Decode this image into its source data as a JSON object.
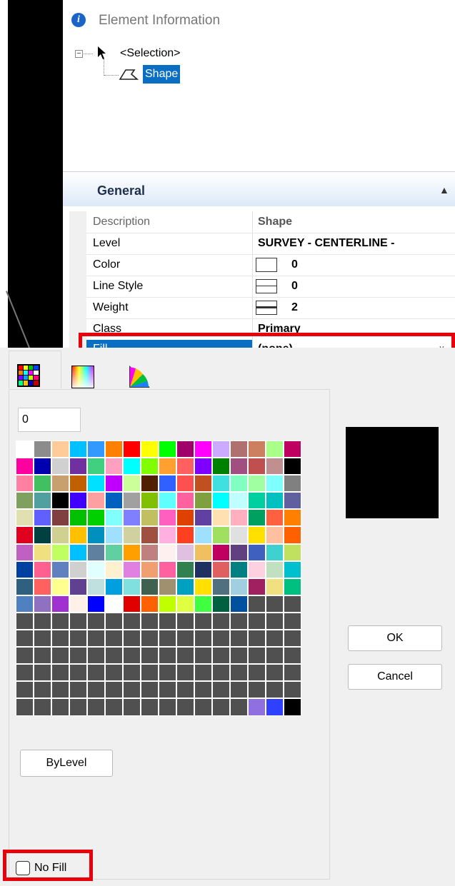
{
  "element_info": {
    "title": "Element Information",
    "info_icon": "info-icon",
    "tree": {
      "expander": "−",
      "root_label": "<Selection>",
      "child_label": "Shape"
    },
    "section_title": "General",
    "properties": [
      {
        "name": "Description",
        "value": "Shape"
      },
      {
        "name": "Level",
        "value": "SURVEY - CENTERLINE -"
      },
      {
        "name": "Color",
        "value": "0",
        "swatch": "color-swatch"
      },
      {
        "name": "Line Style",
        "value": "0",
        "swatch": "line-style-swatch"
      },
      {
        "name": "Weight",
        "value": "2",
        "swatch": "weight-swatch"
      },
      {
        "name": "Class",
        "value": "Primary"
      },
      {
        "name": "Fill",
        "value": "(none)"
      }
    ],
    "highlight_color": "#e8000b",
    "selection_color": "#0a6fc2"
  },
  "color_dialog": {
    "tabs": [
      "palette-icon",
      "gradient-icon",
      "color-wheel-icon"
    ],
    "index_value": "0",
    "preview_color": "#000000",
    "ok_label": "OK",
    "cancel_label": "Cancel",
    "bylevel_label": "ByLevel",
    "nofill_label": "No Fill",
    "nofill_checked": false,
    "palette": [
      [
        "#ffffff",
        "#8c8c8c",
        "#ffcc99",
        "#00c0ff",
        "#3399ff",
        "#ff8000",
        "#ff0000",
        "#ffff00",
        "#00ff00",
        "#a0006a",
        "#ff00ff",
        "#ccaaff",
        "#b07070",
        "#cc8060",
        "#aaff88",
        "#c00060"
      ],
      [
        "#ff00a0",
        "#0000b0",
        "#d0d0d0",
        "#7030a0",
        "#40d080",
        "#ffa0c0",
        "#00ffff",
        "#80ff00",
        "#ffa030",
        "#ff6060",
        "#8000ff",
        "#008000",
        "#a05080",
        "#c05050",
        "#c09090",
        "#000000"
      ],
      [
        "#ff80a0",
        "#40c060",
        "#c8a070",
        "#c06000",
        "#00e0ff",
        "#c000ff",
        "#ccff99",
        "#502000",
        "#3060ff",
        "#ff5050",
        "#c05020",
        "#40e0e0",
        "#80ffc0",
        "#a0ffa0",
        "#80ffff",
        "#808080"
      ],
      [
        "#80a060",
        "#50a0a0",
        "#000000",
        "#4000ff",
        "#ffa0a0",
        "#0060c0",
        "#a0a0a0",
        "#80c000",
        "#60ffff",
        "#ff60a0",
        "#80a040",
        "#00ffff",
        "#c0ffff",
        "#00d0a0",
        "#00c0c0",
        "#6060a0"
      ],
      [
        "#e0e0b0",
        "#6060ff",
        "#804040",
        "#00c000",
        "#00d000",
        "#80ffff",
        "#8080ff",
        "#c0c060",
        "#ff60c0",
        "#e04000",
        "#6040a0",
        "#ffe0b0",
        "#ffb0c0",
        "#00a060",
        "#ff6040",
        "#ff8000"
      ],
      [
        "#e00020",
        "#004040",
        "#d0d090",
        "#ffc000",
        "#0090c0",
        "#a0e0ff",
        "#d0d0a0",
        "#a05040",
        "#ffb0e0",
        "#ff4020",
        "#a0e0ff",
        "#a0e060",
        "#e0e0e0",
        "#ffe000",
        "#ffc0a0",
        "#ff6000"
      ],
      [
        "#c060c0",
        "#f0e080",
        "#c0ff60",
        "#00c0ff",
        "#6080a0",
        "#60d0a0",
        "#ffa000",
        "#c08080",
        "#fff0f0",
        "#e0c0e0",
        "#f0c060",
        "#c00060",
        "#604080",
        "#4060c0",
        "#40d0d0",
        "#c0e060"
      ],
      [
        "#0040a0",
        "#ff6090",
        "#6080c0",
        "#d0d0d0",
        "#e0ffff",
        "#fff0d0",
        "#e080e0",
        "#f0a070",
        "#ff60a0",
        "#308050",
        "#203060",
        "#e06060",
        "#008080",
        "#ffd0e0",
        "#c0e0c0",
        "#00c0d0"
      ],
      [
        "#306080",
        "#ff6060",
        "#ffff90",
        "#604090",
        "#c0e0e0",
        "#00a0e0",
        "#80e0e0",
        "#406050",
        "#a09070",
        "#00a0c0",
        "#ffe000",
        "#507080",
        "#a0d0e0",
        "#a02060",
        "#f0e080",
        "#00c080"
      ],
      [
        "#5080c0",
        "#9070c0",
        "#a030d0",
        "#fff0e8",
        "#0000ff",
        "#ffffff",
        "#e00000",
        "#ff6000",
        "#c0ff00",
        "#e0ff40",
        "#40ff40",
        "#006040",
        "#0050a0",
        "#505050",
        "#505050",
        "#505050"
      ],
      [
        "#505050",
        "#505050",
        "#505050",
        "#505050",
        "#505050",
        "#505050",
        "#505050",
        "#505050",
        "#505050",
        "#505050",
        "#505050",
        "#505050",
        "#505050",
        "#505050",
        "#505050",
        "#505050"
      ],
      [
        "#505050",
        "#505050",
        "#505050",
        "#505050",
        "#505050",
        "#505050",
        "#505050",
        "#505050",
        "#505050",
        "#505050",
        "#505050",
        "#505050",
        "#505050",
        "#505050",
        "#505050",
        "#505050"
      ],
      [
        "#505050",
        "#505050",
        "#505050",
        "#505050",
        "#505050",
        "#505050",
        "#505050",
        "#505050",
        "#505050",
        "#505050",
        "#505050",
        "#505050",
        "#505050",
        "#505050",
        "#505050",
        "#505050"
      ],
      [
        "#505050",
        "#505050",
        "#505050",
        "#505050",
        "#505050",
        "#505050",
        "#505050",
        "#505050",
        "#505050",
        "#505050",
        "#505050",
        "#505050",
        "#505050",
        "#505050",
        "#505050",
        "#505050"
      ],
      [
        "#505050",
        "#505050",
        "#505050",
        "#505050",
        "#505050",
        "#505050",
        "#505050",
        "#505050",
        "#505050",
        "#505050",
        "#505050",
        "#505050",
        "#505050",
        "#505050",
        "#505050",
        "#505050"
      ],
      [
        "#505050",
        "#505050",
        "#505050",
        "#505050",
        "#505050",
        "#505050",
        "#505050",
        "#505050",
        "#505050",
        "#505050",
        "#505050",
        "#505050",
        "#505050",
        "#9070e0",
        "#3040ff",
        "#000000"
      ]
    ]
  }
}
